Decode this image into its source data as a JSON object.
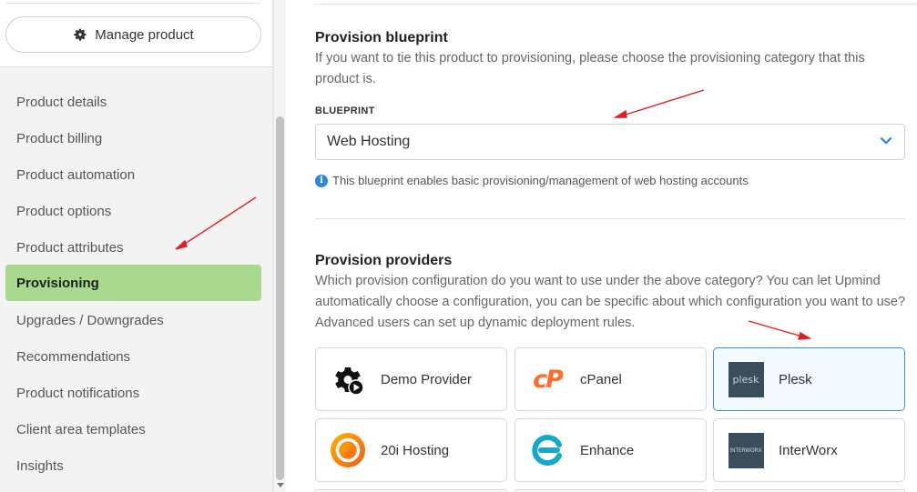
{
  "sidebar": {
    "manage_button": {
      "label": "Manage product",
      "icon": "gear-icon"
    },
    "items": [
      {
        "label": "Product details",
        "active": false
      },
      {
        "label": "Product billing",
        "active": false
      },
      {
        "label": "Product automation",
        "active": false
      },
      {
        "label": "Product options",
        "active": false
      },
      {
        "label": "Product attributes",
        "active": false
      },
      {
        "label": "Provisioning",
        "active": true
      },
      {
        "label": "Upgrades / Downgrades",
        "active": false
      },
      {
        "label": "Recommendations",
        "active": false
      },
      {
        "label": "Product notifications",
        "active": false
      },
      {
        "label": "Client area templates",
        "active": false
      },
      {
        "label": "Insights",
        "active": false
      }
    ],
    "active_color": "#a9d98f"
  },
  "blueprint": {
    "title": "Provision blueprint",
    "description": "If you want to tie this product to provisioning, please choose the provisioning category that this product is.",
    "field_label": "BLUEPRINT",
    "selected_value": "Web Hosting",
    "hint": "This blueprint enables basic provisioning/management of web hosting accounts"
  },
  "providers": {
    "title": "Provision providers",
    "description": "Which provision configuration do you want to use under the above category? You can let Upmind automatically choose a configuration, you can be specific about which configuration you want to use? Advanced users can set up dynamic deployment rules.",
    "items": [
      {
        "name": "Demo Provider",
        "icon": "gear-play-icon",
        "selected": false
      },
      {
        "name": "cPanel",
        "icon": "cpanel-logo-icon",
        "logo_text": "cP",
        "selected": false
      },
      {
        "name": "Plesk",
        "icon": "plesk-logo-icon",
        "logo_text": "plesk",
        "selected": true
      },
      {
        "name": "20i Hosting",
        "icon": "20i-logo-icon",
        "selected": false
      },
      {
        "name": "Enhance",
        "icon": "enhance-logo-icon",
        "selected": false
      },
      {
        "name": "InterWorx",
        "icon": "interworx-logo-icon",
        "logo_text": "INTERWORX",
        "selected": false
      }
    ]
  },
  "colors": {
    "accent_blue": "#2e86de",
    "selected_border": "#3b8fd9",
    "annotation_red": "#e02020"
  }
}
